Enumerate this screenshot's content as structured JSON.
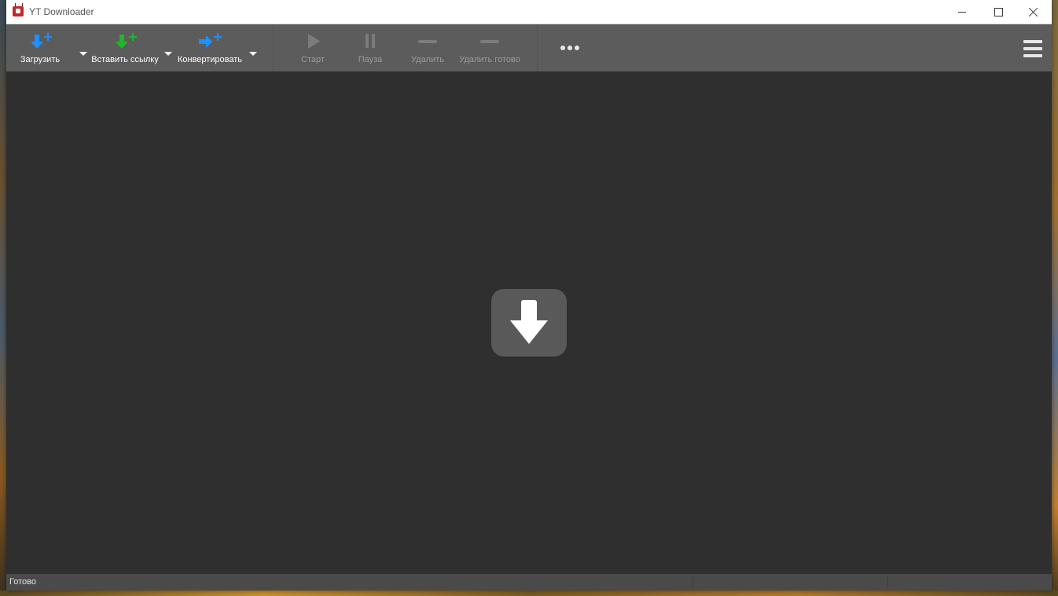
{
  "window": {
    "title": "YT Downloader"
  },
  "toolbar": {
    "download_label": "Загрузить",
    "paste_link_label": "Вставить ссылку",
    "convert_label": "Конвертировать",
    "start_label": "Старт",
    "pause_label": "Пауза",
    "delete_label": "Удалить",
    "delete_done_label": "Удалить готово"
  },
  "status": {
    "text": "Готово"
  },
  "colors": {
    "accent_blue": "#1e90ff",
    "accent_green": "#1fb82a",
    "toolbar_bg": "#5c5c5c",
    "content_bg": "#2f2f2f"
  },
  "icons": {
    "download": "download-plus-icon",
    "paste": "paste-link-plus-icon",
    "convert": "convert-arrow-plus-icon",
    "start": "play-icon",
    "pause": "pause-icon",
    "delete": "minus-icon",
    "delete_done": "minus-icon",
    "more": "more-dots-icon",
    "menu": "hamburger-menu-icon",
    "drop": "download-arrow-icon"
  }
}
